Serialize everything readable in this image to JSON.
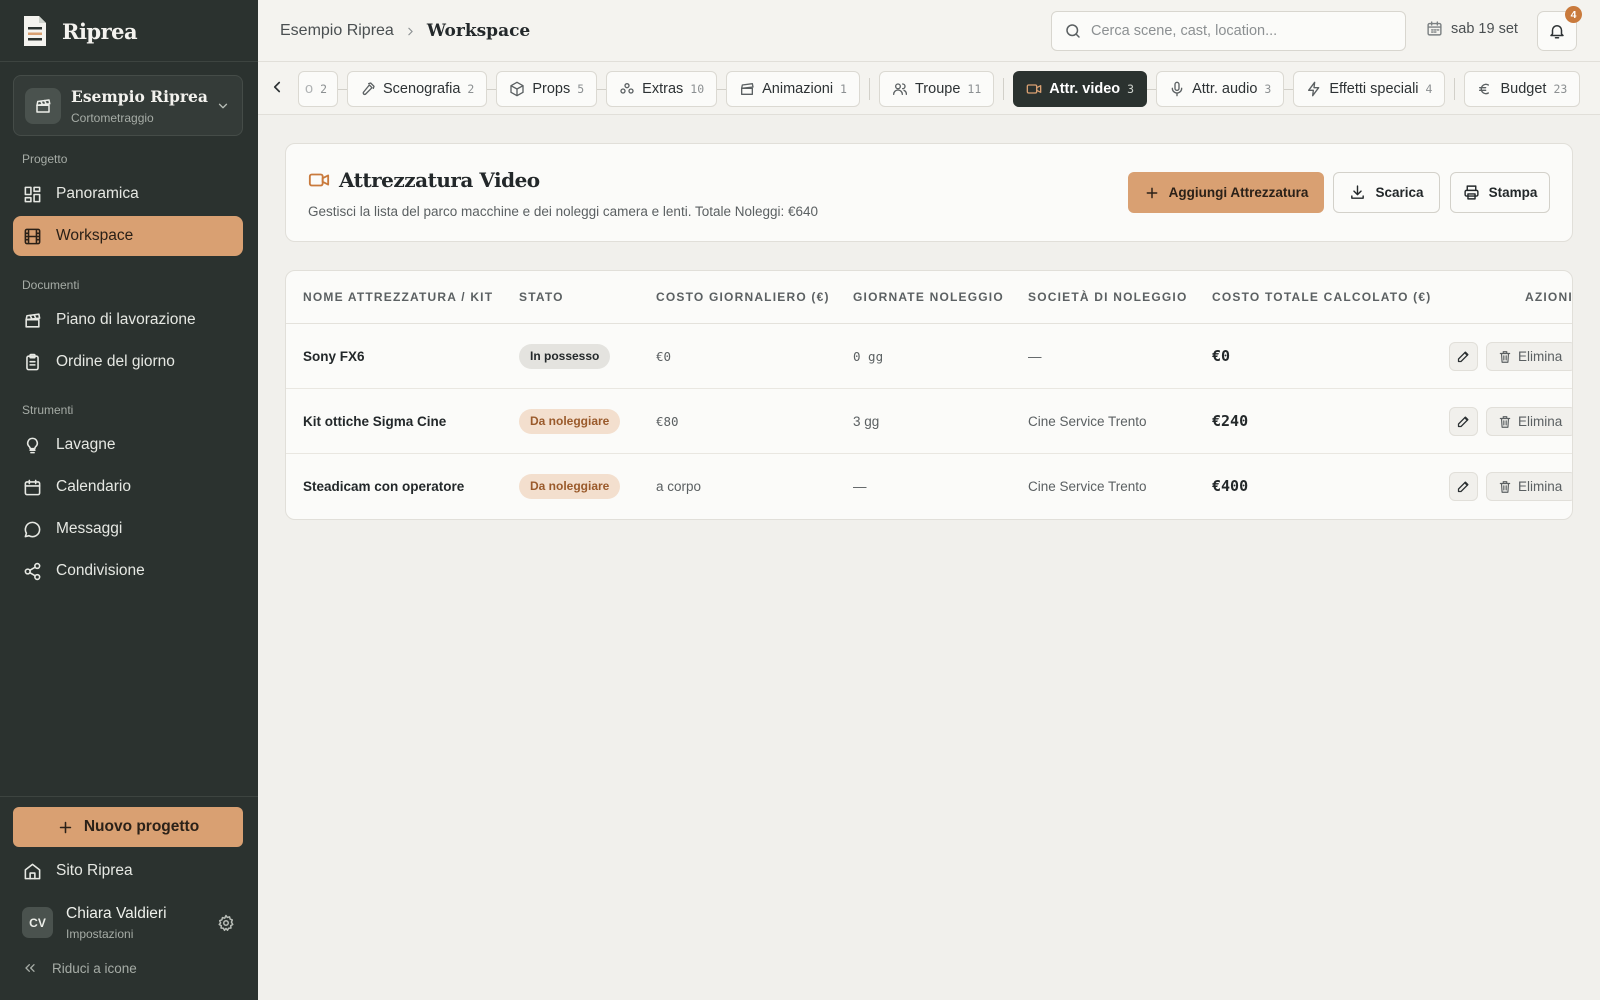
{
  "app": {
    "name": "Riprea",
    "logo_icon": "document-logo-icon"
  },
  "project": {
    "name": "Esempio Riprea",
    "type": "Cortometraggio"
  },
  "sidebar": {
    "sections": [
      {
        "label": "Progetto",
        "items": [
          {
            "label": "Panoramica",
            "icon": "dashboard-icon",
            "active": false
          },
          {
            "label": "Workspace",
            "icon": "film-icon",
            "active": true
          }
        ]
      },
      {
        "label": "Documenti",
        "items": [
          {
            "label": "Piano di lavorazione",
            "icon": "clapperboard-icon",
            "active": false
          },
          {
            "label": "Ordine del giorno",
            "icon": "clipboard-icon",
            "active": false
          }
        ]
      },
      {
        "label": "Strumenti",
        "items": [
          {
            "label": "Lavagne",
            "icon": "lightbulb-icon",
            "active": false
          },
          {
            "label": "Calendario",
            "icon": "calendar-icon",
            "active": false
          },
          {
            "label": "Messaggi",
            "icon": "message-icon",
            "active": false
          },
          {
            "label": "Condivisione",
            "icon": "share-icon",
            "active": false
          }
        ]
      }
    ],
    "new_project_label": "Nuovo progetto",
    "site_label": "Sito Riprea",
    "collapse_label": "Riduci a icone"
  },
  "user": {
    "initials": "CV",
    "name": "Chiara Valdieri",
    "subtitle": "Impostazioni"
  },
  "header": {
    "breadcrumb_parent": "Esempio Riprea",
    "breadcrumb_current": "Workspace",
    "search_placeholder": "Cerca scene, cast, location...",
    "date": "sab 19 set",
    "notifications": "4"
  },
  "tabs": [
    {
      "label": "o",
      "count": "2",
      "icon": "",
      "cut": true
    },
    {
      "label": "Scenografia",
      "count": "2",
      "icon": "hammer-icon"
    },
    {
      "label": "Props",
      "count": "5",
      "icon": "box-icon"
    },
    {
      "label": "Extras",
      "count": "10",
      "icon": "people-group-icon"
    },
    {
      "label": "Animazioni",
      "count": "1",
      "icon": "clapperboard-icon",
      "divider_after": true
    },
    {
      "label": "Troupe",
      "count": "11",
      "icon": "users-icon",
      "divider_after": true
    },
    {
      "label": "Attr. video",
      "count": "3",
      "icon": "video-camera-icon",
      "active": true
    },
    {
      "label": "Attr. audio",
      "count": "3",
      "icon": "microphone-icon"
    },
    {
      "label": "Effetti speciali",
      "count": "4",
      "icon": "zap-icon",
      "divider_after": true
    },
    {
      "label": "Budget",
      "count": "23",
      "icon": "euro-icon"
    }
  ],
  "page": {
    "title": "Attrezzatura Video",
    "description": "Gestisci la lista del parco macchine e dei noleggi camera e lenti. Totale Noleggi: €640",
    "add_label": "Aggiungi Attrezzatura",
    "download_label": "Scarica",
    "print_label": "Stampa"
  },
  "table": {
    "columns": [
      "NOME ATTREZZATURA / KIT",
      "STATO",
      "COSTO GIORNALIERO (€)",
      "GIORNATE NOLEGGIO",
      "SOCIETÀ DI NOLEGGIO",
      "COSTO TOTALE CALCOLATO (€)",
      "AZIONI"
    ],
    "delete_label": "Elimina",
    "rows": [
      {
        "name": "Sony FX6",
        "status": "In possesso",
        "status_type": "own",
        "daily": "€0",
        "days": "0 gg",
        "company": "—",
        "total": "€0"
      },
      {
        "name": "Kit ottiche Sigma Cine",
        "status": "Da noleggiare",
        "status_type": "rent",
        "daily": "€80",
        "days": "3 gg",
        "company": "Cine Service Trento",
        "total": "€240"
      },
      {
        "name": "Steadicam con operatore",
        "status": "Da noleggiare",
        "status_type": "rent",
        "daily": "a corpo",
        "days": "—",
        "company": "Cine Service Trento",
        "total": "€400"
      }
    ]
  },
  "colors": {
    "sidebar_bg": "#2b322f",
    "accent": "#d9a072",
    "page_bg": "#f1f0ec",
    "badge_rent_text": "#9a5a2b",
    "notification_badge": "#c97a3c"
  }
}
